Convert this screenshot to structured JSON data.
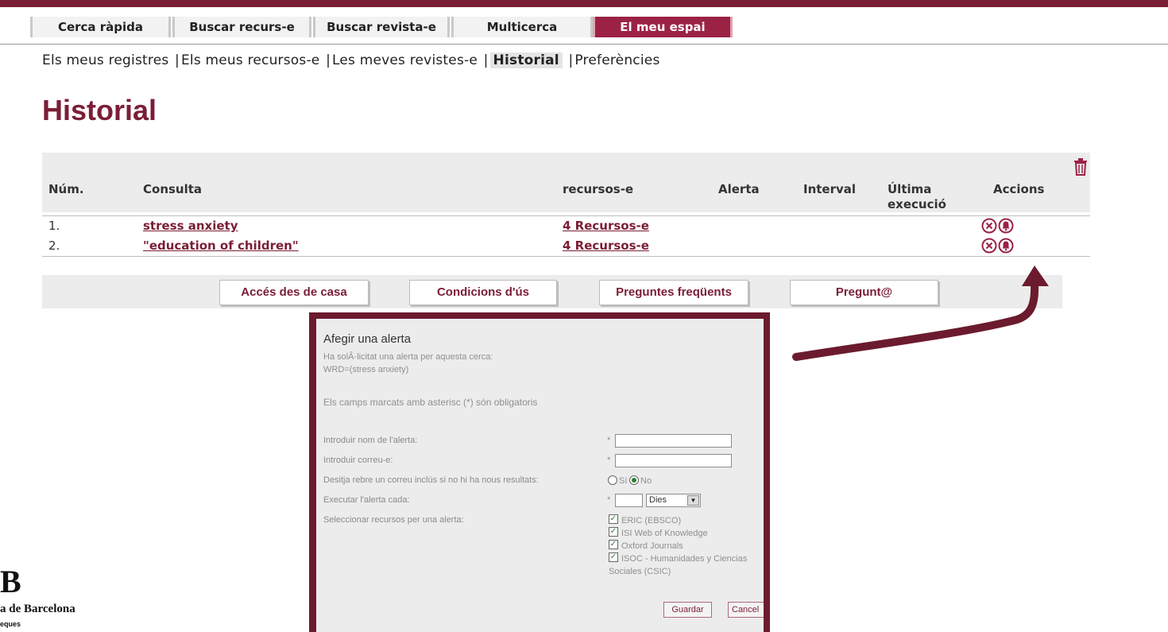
{
  "tabs": [
    {
      "label": "Cerca ràpida"
    },
    {
      "label": "Buscar recurs-e"
    },
    {
      "label": "Buscar revista-e"
    },
    {
      "label": "Multicerca"
    },
    {
      "label": "El meu espai"
    }
  ],
  "subnav": {
    "items": [
      "Els meus registres",
      "Els meus recursos-e",
      "Les meves revistes-e",
      "Historial",
      "Preferències"
    ],
    "separator": "|"
  },
  "page_title": "Historial",
  "table": {
    "headers": {
      "num": "Núm.",
      "query": "Consulta",
      "resources": "recursos-e",
      "alert": "Alerta",
      "interval": "Interval",
      "last_run": "Última execució",
      "actions": "Accions"
    },
    "rows": [
      {
        "num": "1.",
        "query": "stress anxiety",
        "resources": "4 Recursos-e"
      },
      {
        "num": "2.",
        "query": "\"education of children\"",
        "resources": "4 Recursos-e"
      }
    ]
  },
  "footer_buttons": [
    "Accés des de casa",
    "Condicions d'ús",
    "Preguntes freqüents",
    "Pregunt@"
  ],
  "popup": {
    "title": "Afegir una alerta",
    "line1": "Ha solÂ·licitat una alerta per aquesta cerca:",
    "line2": "WRD=(stress anxiety)",
    "required_note": "Els camps marcats amb asterisc (*) són obligatoris",
    "label_name": "Introduir nom de l'alerta:",
    "label_email": "Introduir correu-e:",
    "label_mail_empty": "Desitja rebre un correu inclús si no hi ha nous resultats:",
    "label_run": "Executar l'alerta cada:",
    "label_resources": "Seleccionar recursos per una alerta:",
    "asterisk": "*",
    "radio_yes": "Sí",
    "radio_no": "No",
    "interval_unit": "Dies",
    "resources": [
      "ERIC (EBSCO)",
      "ISI Web of Knowledge",
      "Oxford Journals",
      "ISOC - Humanidades y Ciencias",
      "Sociales (CSIC)"
    ],
    "save": "Guardar",
    "cancel": "Cancel"
  },
  "logo": {
    "letter": "B",
    "line1": "a de Barcelona",
    "line2": "eques"
  },
  "colors": {
    "accent": "#7b1e35",
    "active_tab": "#9b2245"
  }
}
